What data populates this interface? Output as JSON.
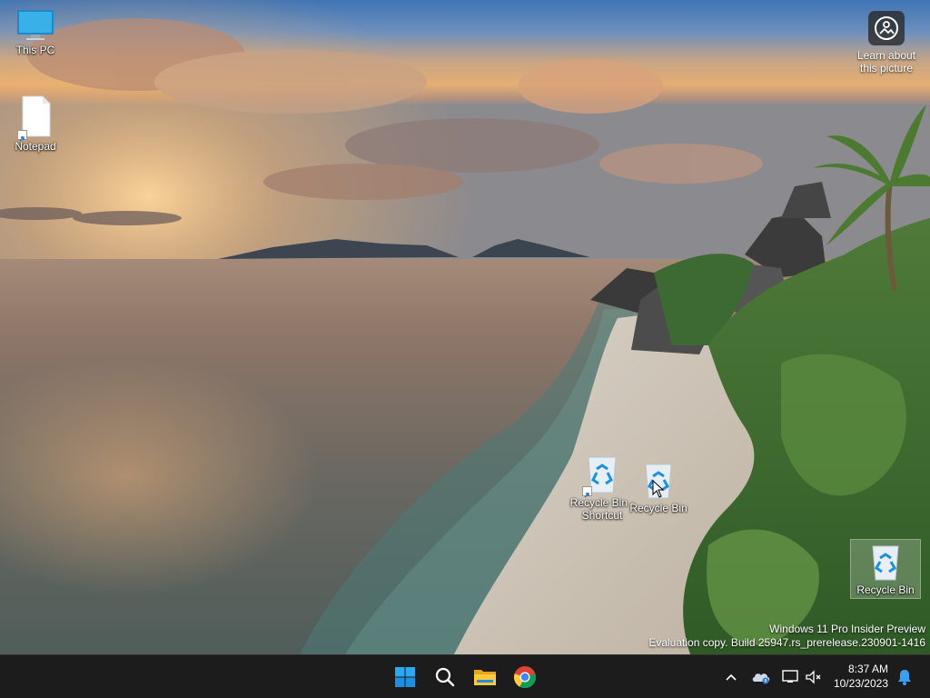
{
  "desktop": {
    "icons": [
      {
        "label": "This PC",
        "icon": "monitor-icon"
      },
      {
        "label": "Notepad",
        "icon": "notepad-icon"
      },
      {
        "label": "Recycle Bin - Shortcut",
        "icon": "recycle-bin-icon"
      },
      {
        "label": "Recycle Bin",
        "icon": "recycle-bin-icon"
      },
      {
        "label": "Recycle Bin",
        "icon": "recycle-bin-icon"
      }
    ],
    "learn": {
      "line1": "Learn about",
      "line2": "this picture"
    },
    "watermark": {
      "line1": "Windows 11 Pro Insider Preview",
      "line2": "Evaluation copy. Build 25947.rs_prerelease.230901-1416"
    }
  },
  "taskbar": {
    "apps": [
      "windows-start-icon",
      "search-icon",
      "file-explorer-icon",
      "chrome-icon"
    ],
    "tray": [
      "chevron-up-icon",
      "onedrive-icon",
      "network-icon",
      "volume-muted-icon"
    ],
    "time": "8:37 AM",
    "date": "10/23/2023",
    "notification": "bell-icon"
  },
  "colors": {
    "taskbar": "#1c1c1c",
    "accent": "#0078d4"
  }
}
